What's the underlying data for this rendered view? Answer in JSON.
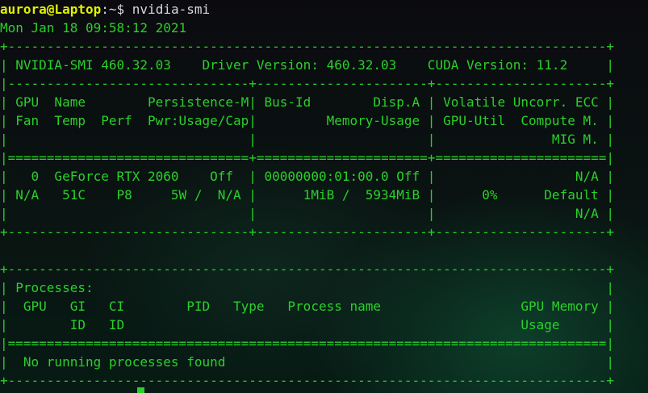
{
  "prompt": {
    "user_host": "aurora@Laptop",
    "separator": ":",
    "path": "~",
    "dollar": "$",
    "command": " nvidia-smi"
  },
  "date": "Mon Jan 18 09:58:12 2021",
  "output_lines": [
    "+-----------------------------------------------------------------------------+",
    "| NVIDIA-SMI 460.32.03    Driver Version: 460.32.03    CUDA Version: 11.2     |",
    "|-------------------------------+----------------------+----------------------+",
    "| GPU  Name        Persistence-M| Bus-Id        Disp.A | Volatile Uncorr. ECC |",
    "| Fan  Temp  Perf  Pwr:Usage/Cap|         Memory-Usage | GPU-Util  Compute M. |",
    "|                               |                      |               MIG M. |",
    "|===============================+======================+======================|",
    "|   0  GeForce RTX 2060    Off  | 00000000:01:00.0 Off |                  N/A |",
    "| N/A   51C    P8     5W /  N/A |      1MiB /  5934MiB |      0%      Default |",
    "|                               |                      |                  N/A |",
    "+-------------------------------+----------------------+----------------------+",
    "                                                                               ",
    "+-----------------------------------------------------------------------------+",
    "| Processes:                                                                  |",
    "|  GPU   GI   CI        PID   Type   Process name                  GPU Memory |",
    "|        ID   ID                                                   Usage      |",
    "|=============================================================================|",
    "|  No running processes found                                                 |",
    "+-----------------------------------------------------------------------------+"
  ],
  "colors": {
    "output_green": "#2ad02a",
    "prompt_user_yellow": "#e0f000",
    "prompt_text_gray": "#d8d8d8"
  }
}
